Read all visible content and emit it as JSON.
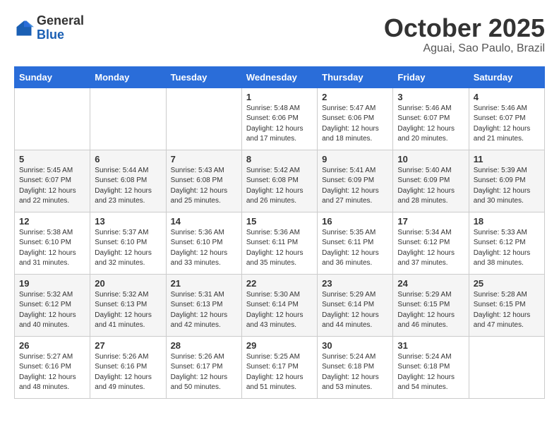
{
  "header": {
    "logo_line1": "General",
    "logo_line2": "Blue",
    "month": "October 2025",
    "location": "Aguai, Sao Paulo, Brazil"
  },
  "weekdays": [
    "Sunday",
    "Monday",
    "Tuesday",
    "Wednesday",
    "Thursday",
    "Friday",
    "Saturday"
  ],
  "weeks": [
    [
      {
        "day": "",
        "text": ""
      },
      {
        "day": "",
        "text": ""
      },
      {
        "day": "",
        "text": ""
      },
      {
        "day": "1",
        "text": "Sunrise: 5:48 AM\nSunset: 6:06 PM\nDaylight: 12 hours\nand 17 minutes."
      },
      {
        "day": "2",
        "text": "Sunrise: 5:47 AM\nSunset: 6:06 PM\nDaylight: 12 hours\nand 18 minutes."
      },
      {
        "day": "3",
        "text": "Sunrise: 5:46 AM\nSunset: 6:07 PM\nDaylight: 12 hours\nand 20 minutes."
      },
      {
        "day": "4",
        "text": "Sunrise: 5:46 AM\nSunset: 6:07 PM\nDaylight: 12 hours\nand 21 minutes."
      }
    ],
    [
      {
        "day": "5",
        "text": "Sunrise: 5:45 AM\nSunset: 6:07 PM\nDaylight: 12 hours\nand 22 minutes."
      },
      {
        "day": "6",
        "text": "Sunrise: 5:44 AM\nSunset: 6:08 PM\nDaylight: 12 hours\nand 23 minutes."
      },
      {
        "day": "7",
        "text": "Sunrise: 5:43 AM\nSunset: 6:08 PM\nDaylight: 12 hours\nand 25 minutes."
      },
      {
        "day": "8",
        "text": "Sunrise: 5:42 AM\nSunset: 6:08 PM\nDaylight: 12 hours\nand 26 minutes."
      },
      {
        "day": "9",
        "text": "Sunrise: 5:41 AM\nSunset: 6:09 PM\nDaylight: 12 hours\nand 27 minutes."
      },
      {
        "day": "10",
        "text": "Sunrise: 5:40 AM\nSunset: 6:09 PM\nDaylight: 12 hours\nand 28 minutes."
      },
      {
        "day": "11",
        "text": "Sunrise: 5:39 AM\nSunset: 6:09 PM\nDaylight: 12 hours\nand 30 minutes."
      }
    ],
    [
      {
        "day": "12",
        "text": "Sunrise: 5:38 AM\nSunset: 6:10 PM\nDaylight: 12 hours\nand 31 minutes."
      },
      {
        "day": "13",
        "text": "Sunrise: 5:37 AM\nSunset: 6:10 PM\nDaylight: 12 hours\nand 32 minutes."
      },
      {
        "day": "14",
        "text": "Sunrise: 5:36 AM\nSunset: 6:10 PM\nDaylight: 12 hours\nand 33 minutes."
      },
      {
        "day": "15",
        "text": "Sunrise: 5:36 AM\nSunset: 6:11 PM\nDaylight: 12 hours\nand 35 minutes."
      },
      {
        "day": "16",
        "text": "Sunrise: 5:35 AM\nSunset: 6:11 PM\nDaylight: 12 hours\nand 36 minutes."
      },
      {
        "day": "17",
        "text": "Sunrise: 5:34 AM\nSunset: 6:12 PM\nDaylight: 12 hours\nand 37 minutes."
      },
      {
        "day": "18",
        "text": "Sunrise: 5:33 AM\nSunset: 6:12 PM\nDaylight: 12 hours\nand 38 minutes."
      }
    ],
    [
      {
        "day": "19",
        "text": "Sunrise: 5:32 AM\nSunset: 6:12 PM\nDaylight: 12 hours\nand 40 minutes."
      },
      {
        "day": "20",
        "text": "Sunrise: 5:32 AM\nSunset: 6:13 PM\nDaylight: 12 hours\nand 41 minutes."
      },
      {
        "day": "21",
        "text": "Sunrise: 5:31 AM\nSunset: 6:13 PM\nDaylight: 12 hours\nand 42 minutes."
      },
      {
        "day": "22",
        "text": "Sunrise: 5:30 AM\nSunset: 6:14 PM\nDaylight: 12 hours\nand 43 minutes."
      },
      {
        "day": "23",
        "text": "Sunrise: 5:29 AM\nSunset: 6:14 PM\nDaylight: 12 hours\nand 44 minutes."
      },
      {
        "day": "24",
        "text": "Sunrise: 5:29 AM\nSunset: 6:15 PM\nDaylight: 12 hours\nand 46 minutes."
      },
      {
        "day": "25",
        "text": "Sunrise: 5:28 AM\nSunset: 6:15 PM\nDaylight: 12 hours\nand 47 minutes."
      }
    ],
    [
      {
        "day": "26",
        "text": "Sunrise: 5:27 AM\nSunset: 6:16 PM\nDaylight: 12 hours\nand 48 minutes."
      },
      {
        "day": "27",
        "text": "Sunrise: 5:26 AM\nSunset: 6:16 PM\nDaylight: 12 hours\nand 49 minutes."
      },
      {
        "day": "28",
        "text": "Sunrise: 5:26 AM\nSunset: 6:17 PM\nDaylight: 12 hours\nand 50 minutes."
      },
      {
        "day": "29",
        "text": "Sunrise: 5:25 AM\nSunset: 6:17 PM\nDaylight: 12 hours\nand 51 minutes."
      },
      {
        "day": "30",
        "text": "Sunrise: 5:24 AM\nSunset: 6:18 PM\nDaylight: 12 hours\nand 53 minutes."
      },
      {
        "day": "31",
        "text": "Sunrise: 5:24 AM\nSunset: 6:18 PM\nDaylight: 12 hours\nand 54 minutes."
      },
      {
        "day": "",
        "text": ""
      }
    ]
  ]
}
